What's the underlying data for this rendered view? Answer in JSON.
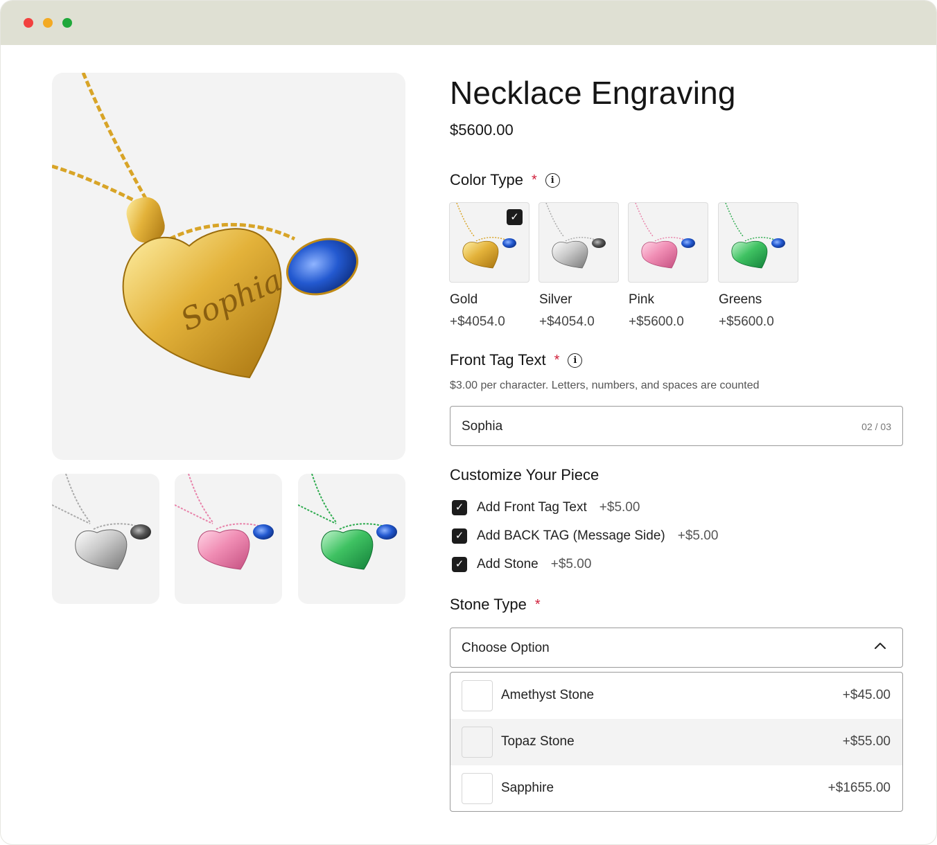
{
  "product": {
    "title": "Necklace Engraving",
    "price": "$5600.00",
    "engraving_text": "Sophia"
  },
  "gallery": {
    "main_variant": "Gold",
    "thumbnails": [
      "Silver",
      "Pink",
      "Greens"
    ]
  },
  "color_type": {
    "label": "Color Type",
    "required_mark": "*",
    "options": [
      {
        "name": "Gold",
        "price": "+$4054.0",
        "selected": true
      },
      {
        "name": "Silver",
        "price": "+$4054.0",
        "selected": false
      },
      {
        "name": "Pink",
        "price": "+$5600.0",
        "selected": false
      },
      {
        "name": "Greens",
        "price": "+$5600.0",
        "selected": false
      }
    ]
  },
  "front_tag": {
    "label": "Front Tag Text",
    "required_mark": "*",
    "hint": "$3.00 per character. Letters, numbers, and spaces are counted",
    "value": "Sophia",
    "counter": "02 / 03"
  },
  "customize": {
    "label": "Customize Your Piece",
    "options": [
      {
        "label": "Add Front Tag Text",
        "price": "+$5.00",
        "checked": true
      },
      {
        "label": "Add BACK TAG (Message Side)",
        "price": "+$5.00",
        "checked": true
      },
      {
        "label": "Add Stone",
        "price": "+$5.00",
        "checked": true
      }
    ]
  },
  "stone_type": {
    "label": "Stone Type",
    "required_mark": "*",
    "placeholder": "Choose Option",
    "options": [
      {
        "name": "Amethyst Stone",
        "price": "+$45.00"
      },
      {
        "name": "Topaz Stone",
        "price": "+$55.00"
      },
      {
        "name": "Sapphire",
        "price": "+$1655.00"
      }
    ]
  },
  "colors": {
    "gold": "#d9a425",
    "silver": "#b9b9b9",
    "pink": "#ef8fb3",
    "green": "#39b85a",
    "stone_blue": "#1f55c8",
    "required": "#d0203b",
    "check_bg": "#1c1c1c"
  }
}
